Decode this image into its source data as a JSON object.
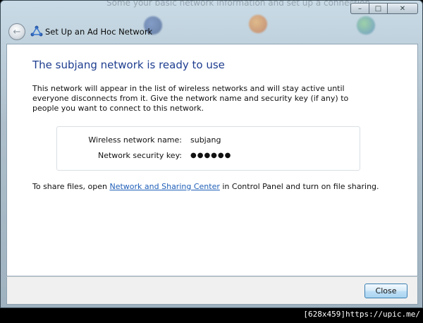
{
  "window": {
    "background_text": "Some your basic network information and set up a connection",
    "caption": {
      "minimize": "–",
      "maximize": "□",
      "close": "✕"
    }
  },
  "nav": {
    "back_icon": "back-arrow-icon",
    "wizard_icon": "network-wizard-icon",
    "title": "Set Up an Ad Hoc Network"
  },
  "content": {
    "heading": "The subjang network is ready to use",
    "description": "This network will appear in the list of wireless networks and will stay active until everyone disconnects from it. Give the network name and security key (if any) to people you want to connect to this network.",
    "info": {
      "name_label": "Wireless network name:",
      "name_value": "subjang",
      "key_label": "Network security key:",
      "key_value": "●●●●●●"
    },
    "share": {
      "prefix": "To share files, open ",
      "link": "Network and Sharing Center",
      "suffix": " in Control Panel and turn on file sharing."
    }
  },
  "footer": {
    "close_label": "Close"
  },
  "strip": {
    "text": "[628x459]https://upic.me/"
  },
  "colors": {
    "heading": "#1e3d8f",
    "link": "#1f5fb8",
    "button_border": "#3c7fb1"
  }
}
